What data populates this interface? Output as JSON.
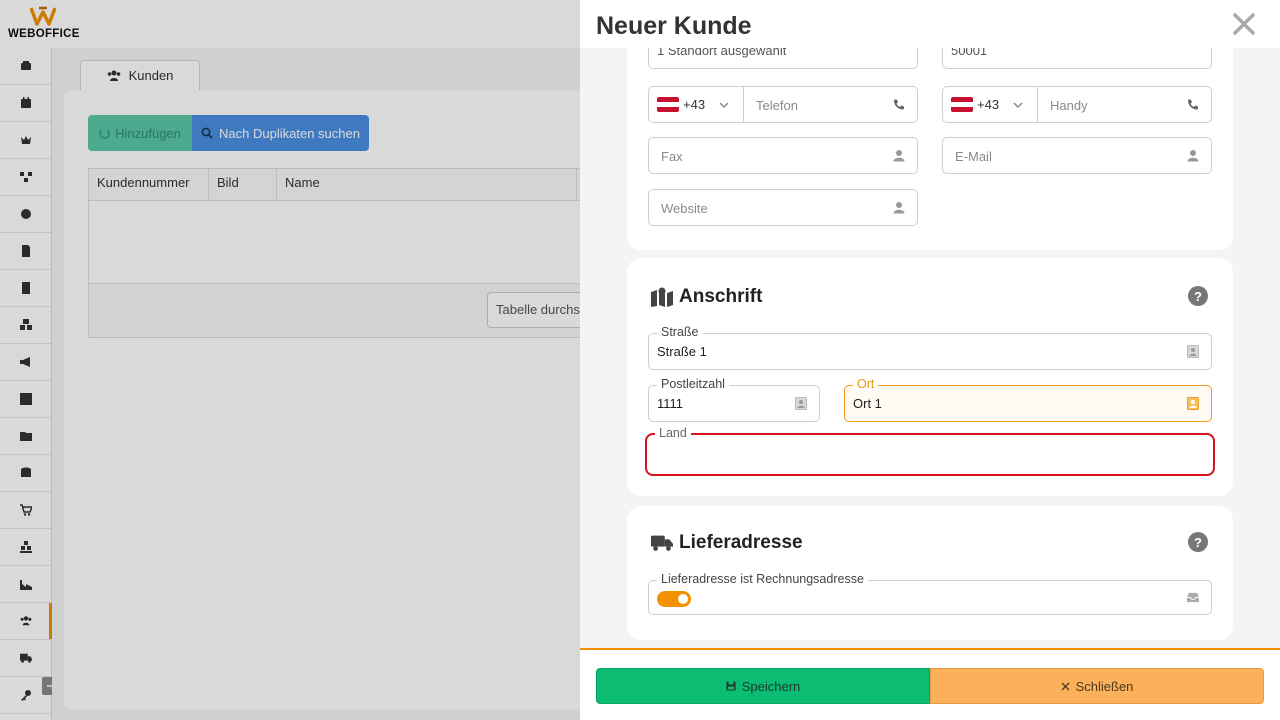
{
  "app": {
    "brand": "WEBOFFICE"
  },
  "sidebar": {
    "icons": [
      "inbox-icon",
      "calendar-icon",
      "crown-icon",
      "network-icon",
      "clock-icon",
      "document-icon",
      "list-document-icon",
      "cubes-icon",
      "megaphone-icon",
      "chart-icon",
      "folder-icon",
      "database-icon",
      "cart-icon",
      "warehouse-icon",
      "industry-icon",
      "users-icon",
      "truck-icon",
      "key-icon"
    ],
    "active_index": 15
  },
  "tab": {
    "label": "Kunden"
  },
  "toolbar": {
    "add_label": "Hinzufügen",
    "duplicates_label": "Nach Duplikaten suchen"
  },
  "table": {
    "columns": [
      "Kundennummer",
      "Bild",
      "Name"
    ],
    "search_placeholder": "Tabelle durchsuchen"
  },
  "modal": {
    "title": "Neuer Kunde",
    "top_cutoff": {
      "left_value": "1 Standort ausgewählt",
      "right_value": "50001"
    },
    "contact": {
      "phone_code": "+43",
      "phone_placeholder": "Telefon",
      "mobile_code": "+43",
      "mobile_placeholder": "Handy",
      "fax_placeholder": "Fax",
      "email_placeholder": "E-Mail",
      "website_placeholder": "Website"
    },
    "address": {
      "title": "Anschrift",
      "help": "?",
      "street_label": "Straße",
      "street_value": "Straße 1",
      "zip_label": "Postleitzahl",
      "zip_value": "1111",
      "city_label": "Ort",
      "city_value": "Ort 1",
      "country_label": "Land",
      "country_value": ""
    },
    "delivery": {
      "title": "Lieferadresse",
      "help": "?",
      "same_label": "Lieferadresse ist Rechnungsadresse",
      "same_enabled": true
    },
    "footer": {
      "save_label": "Speichern",
      "close_label": "Schließen"
    }
  },
  "colors": {
    "accent": "#f39200",
    "save": "#0cbc73",
    "close": "#fbb05a",
    "error": "#d9111b"
  }
}
